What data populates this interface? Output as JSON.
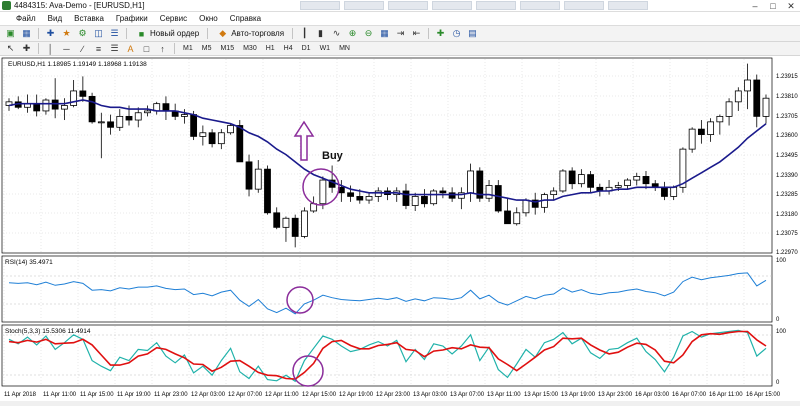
{
  "window": {
    "title": "4484315: Ava-Demo - [EURUSD,H1]"
  },
  "menu": [
    "Файл",
    "Вид",
    "Вставка",
    "Графики",
    "Сервис",
    "Окно",
    "Справка"
  ],
  "toolbar": {
    "new_order": "Новый ордер",
    "autotrading": "Авто-торговля"
  },
  "timeframes": [
    "M1",
    "M5",
    "M15",
    "M30",
    "H1",
    "H4",
    "D1",
    "W1",
    "MN"
  ],
  "main_chart": {
    "header": "EURUSD,H1  1.18985 1.19149 1.18968 1.19138",
    "price_labels": [
      "1.23915",
      "1.23810",
      "1.23705",
      "1.23600",
      "1.23495",
      "1.23390",
      "1.23285",
      "1.23180",
      "1.23075",
      "1.22970"
    ],
    "annotation_buy": "Buy"
  },
  "rsi": {
    "header": "RSI(14) 35.4971",
    "scale": [
      "100",
      "0"
    ]
  },
  "stoch": {
    "header": "Stoch(5,3,3) 15.5306 11.4914",
    "scale": [
      "100",
      "0"
    ]
  },
  "time_labels": [
    "11 Apr 2018",
    "11 Apr 11:00",
    "11 Apr 15:00",
    "11 Apr 19:00",
    "11 Apr 23:00",
    "12 Apr 03:00",
    "12 Apr 07:00",
    "12 Apr 11:00",
    "12 Apr 15:00",
    "12 Apr 19:00",
    "12 Apr 23:00",
    "13 Apr 03:00",
    "13 Apr 07:00",
    "13 Apr 11:00",
    "13 Apr 15:00",
    "13 Apr 19:00",
    "13 Apr 23:00",
    "16 Apr 03:00",
    "16 Apr 07:00",
    "16 Apr 11:00",
    "16 Apr 15:00"
  ],
  "colors": {
    "ma": "#1a1a8c",
    "rsi": "#1e7fd6",
    "stoch_main": "#20b2aa",
    "stoch_signal": "#e01010",
    "annotation": "#8b2d9b"
  },
  "chart_data": {
    "type": "candlestick",
    "symbol": "EURUSD",
    "timeframe": "H1",
    "ylim": [
      1.2292,
      1.2397
    ],
    "candles": [
      [
        1.2372,
        1.2376,
        1.2369,
        1.2374
      ],
      [
        1.2374,
        1.2377,
        1.237,
        1.2371
      ],
      [
        1.2371,
        1.2378,
        1.2368,
        1.2373
      ],
      [
        1.2373,
        1.2378,
        1.2366,
        1.2369
      ],
      [
        1.2369,
        1.2376,
        1.2367,
        1.2375
      ],
      [
        1.2375,
        1.2387,
        1.2365,
        1.237
      ],
      [
        1.237,
        1.2376,
        1.2364,
        1.2372
      ],
      [
        1.2372,
        1.2386,
        1.2371,
        1.238
      ],
      [
        1.238,
        1.2388,
        1.2374,
        1.2377
      ],
      [
        1.2377,
        1.2379,
        1.2362,
        1.2363
      ],
      [
        1.2363,
        1.2368,
        1.2343,
        1.2363
      ],
      [
        1.2363,
        1.2367,
        1.2356,
        1.236
      ],
      [
        1.236,
        1.237,
        1.2358,
        1.2366
      ],
      [
        1.2366,
        1.2372,
        1.2361,
        1.2364
      ],
      [
        1.2364,
        1.2371,
        1.236,
        1.2368
      ],
      [
        1.2368,
        1.2372,
        1.2366,
        1.2369
      ],
      [
        1.2369,
        1.2374,
        1.2367,
        1.2373
      ],
      [
        1.2373,
        1.2377,
        1.2364,
        1.2369
      ],
      [
        1.2369,
        1.2373,
        1.2364,
        1.2366
      ],
      [
        1.2366,
        1.237,
        1.2362,
        1.2367
      ],
      [
        1.2367,
        1.2369,
        1.2353,
        1.2355
      ],
      [
        1.2355,
        1.2361,
        1.235,
        1.2357
      ],
      [
        1.2357,
        1.2359,
        1.2349,
        1.2351
      ],
      [
        1.2351,
        1.2359,
        1.2348,
        1.2357
      ],
      [
        1.2357,
        1.2362,
        1.2356,
        1.2361
      ],
      [
        1.2361,
        1.2364,
        1.2341,
        1.2341
      ],
      [
        1.2341,
        1.2345,
        1.2322,
        1.2326
      ],
      [
        1.2326,
        1.2342,
        1.2324,
        1.2337
      ],
      [
        1.2337,
        1.2339,
        1.2312,
        1.2313
      ],
      [
        1.2313,
        1.2316,
        1.2304,
        1.2305
      ],
      [
        1.2305,
        1.2311,
        1.2297,
        1.231
      ],
      [
        1.231,
        1.2312,
        1.2294,
        1.23
      ],
      [
        1.23,
        1.2316,
        1.2299,
        1.2314
      ],
      [
        1.2314,
        1.2322,
        1.2313,
        1.2318
      ],
      [
        1.2318,
        1.2333,
        1.2315,
        1.2331
      ],
      [
        1.2331,
        1.2339,
        1.2324,
        1.2327
      ],
      [
        1.2327,
        1.2331,
        1.2319,
        1.2324
      ],
      [
        1.2324,
        1.2328,
        1.2319,
        1.2322
      ],
      [
        1.2322,
        1.2326,
        1.2318,
        1.232
      ],
      [
        1.232,
        1.2324,
        1.2318,
        1.2322
      ],
      [
        1.2322,
        1.2327,
        1.2319,
        1.2325
      ],
      [
        1.2325,
        1.2327,
        1.232,
        1.2323
      ],
      [
        1.2323,
        1.2327,
        1.2319,
        1.2325
      ],
      [
        1.2325,
        1.2329,
        1.2315,
        1.2317
      ],
      [
        1.2317,
        1.2324,
        1.2314,
        1.2322
      ],
      [
        1.2322,
        1.2326,
        1.2316,
        1.2318
      ],
      [
        1.2318,
        1.2326,
        1.2317,
        1.2325
      ],
      [
        1.2325,
        1.2327,
        1.2321,
        1.2324
      ],
      [
        1.2324,
        1.2327,
        1.2319,
        1.2321
      ],
      [
        1.2321,
        1.2327,
        1.2315,
        1.2324
      ],
      [
        1.2324,
        1.234,
        1.2319,
        1.2336
      ],
      [
        1.2336,
        1.2338,
        1.2319,
        1.2321
      ],
      [
        1.2321,
        1.2331,
        1.2319,
        1.2328
      ],
      [
        1.2328,
        1.2331,
        1.2313,
        1.2314
      ],
      [
        1.2314,
        1.2321,
        1.2307,
        1.2307
      ],
      [
        1.2307,
        1.2316,
        1.2306,
        1.2313
      ],
      [
        1.2313,
        1.2321,
        1.2311,
        1.232
      ],
      [
        1.232,
        1.2324,
        1.2312,
        1.2316
      ],
      [
        1.2316,
        1.2324,
        1.2313,
        1.2323
      ],
      [
        1.2323,
        1.2327,
        1.232,
        1.2325
      ],
      [
        1.2325,
        1.2337,
        1.2324,
        1.2336
      ],
      [
        1.2336,
        1.2338,
        1.2326,
        1.2329
      ],
      [
        1.2329,
        1.2337,
        1.2327,
        1.2334
      ],
      [
        1.2334,
        1.2336,
        1.2324,
        1.2327
      ],
      [
        1.2327,
        1.2329,
        1.2322,
        1.2325
      ],
      [
        1.2325,
        1.2331,
        1.2323,
        1.2327
      ],
      [
        1.2327,
        1.233,
        1.2325,
        1.2328
      ],
      [
        1.2328,
        1.2332,
        1.2326,
        1.2331
      ],
      [
        1.2331,
        1.2335,
        1.2328,
        1.2333
      ],
      [
        1.2333,
        1.2336,
        1.2326,
        1.2329
      ],
      [
        1.2329,
        1.2331,
        1.2325,
        1.2327
      ],
      [
        1.2327,
        1.233,
        1.232,
        1.2322
      ],
      [
        1.2322,
        1.2328,
        1.232,
        1.2327
      ],
      [
        1.2327,
        1.2349,
        1.2324,
        1.2348
      ],
      [
        1.2348,
        1.236,
        1.2346,
        1.2359
      ],
      [
        1.2359,
        1.2364,
        1.2351,
        1.2356
      ],
      [
        1.2356,
        1.2365,
        1.2352,
        1.2363
      ],
      [
        1.2363,
        1.2367,
        1.2356,
        1.2366
      ],
      [
        1.2366,
        1.2376,
        1.2361,
        1.2374
      ],
      [
        1.2374,
        1.2382,
        1.2369,
        1.238
      ],
      [
        1.238,
        1.2395,
        1.237,
        1.2386
      ],
      [
        1.2386,
        1.2389,
        1.236,
        1.2366
      ],
      [
        1.2366,
        1.2378,
        1.2362,
        1.2376
      ]
    ],
    "ma": [
      1.2372,
      1.2373,
      1.2373,
      1.2373,
      1.2373,
      1.2373,
      1.2373,
      1.2374,
      1.2375,
      1.2374,
      1.2372,
      1.2371,
      1.2371,
      1.237,
      1.237,
      1.237,
      1.2369,
      1.2369,
      1.2369,
      1.2368,
      1.2367,
      1.2365,
      1.2364,
      1.2363,
      1.2362,
      1.236,
      1.2357,
      1.2355,
      1.2352,
      1.2348,
      1.2345,
      1.2341,
      1.2337,
      1.2334,
      1.2332,
      1.233,
      1.2328,
      1.2326,
      1.2325,
      1.2324,
      1.2324,
      1.2324,
      1.2324,
      1.2323,
      1.2323,
      1.2323,
      1.2323,
      1.2323,
      1.2323,
      1.2323,
      1.2324,
      1.2323,
      1.2323,
      1.2322,
      1.2321,
      1.232,
      1.232,
      1.2319,
      1.232,
      1.232,
      1.2322,
      1.2323,
      1.2324,
      1.2324,
      1.2325,
      1.2325,
      1.2326,
      1.2326,
      1.2327,
      1.2327,
      1.2327,
      1.2327,
      1.2327,
      1.2329,
      1.2332,
      1.2335,
      1.2338,
      1.2341,
      1.2345,
      1.2349,
      1.2354,
      1.2358,
      1.2362
    ],
    "rsi": [
      60,
      59,
      60,
      57,
      61,
      56,
      58,
      62,
      59,
      48,
      49,
      47,
      52,
      50,
      53,
      53,
      55,
      51,
      49,
      50,
      41,
      43,
      39,
      45,
      48,
      32,
      22,
      33,
      18,
      12,
      19,
      10,
      26,
      32,
      40,
      36,
      33,
      32,
      31,
      33,
      35,
      33,
      36,
      30,
      34,
      31,
      36,
      35,
      33,
      36,
      48,
      34,
      40,
      29,
      24,
      31,
      38,
      34,
      40,
      42,
      52,
      45,
      49,
      43,
      41,
      44,
      45,
      48,
      50,
      46,
      44,
      39,
      45,
      62,
      69,
      65,
      68,
      70,
      72,
      75,
      76,
      55,
      64
    ],
    "stoch_main": [
      78,
      70,
      82,
      68,
      84,
      60,
      72,
      86,
      78,
      40,
      30,
      22,
      46,
      40,
      60,
      58,
      72,
      48,
      36,
      50,
      18,
      30,
      14,
      40,
      62,
      20,
      8,
      30,
      6,
      4,
      14,
      3,
      40,
      62,
      84,
      78,
      66,
      56,
      60,
      68,
      74,
      66,
      76,
      38,
      60,
      42,
      70,
      66,
      52,
      66,
      86,
      40,
      64,
      24,
      10,
      34,
      60,
      46,
      72,
      78,
      90,
      70,
      80,
      54,
      44,
      60,
      62,
      72,
      80,
      56,
      42,
      20,
      46,
      84,
      92,
      82,
      88,
      90,
      92,
      94,
      90,
      48,
      62
    ],
    "stoch_signal": [
      74,
      72,
      76,
      73,
      78,
      70,
      71,
      72,
      78,
      68,
      50,
      32,
      32,
      36,
      48,
      52,
      63,
      60,
      52,
      45,
      34,
      33,
      21,
      28,
      39,
      40,
      30,
      19,
      14,
      13,
      8,
      7,
      19,
      35,
      62,
      74,
      76,
      67,
      61,
      61,
      67,
      69,
      72,
      60,
      58,
      47,
      57,
      59,
      63,
      61,
      68,
      64,
      63,
      43,
      33,
      22,
      34,
      46,
      59,
      65,
      80,
      79,
      80,
      68,
      59,
      52,
      55,
      64,
      71,
      69,
      59,
      39,
      36,
      50,
      74,
      86,
      88,
      87,
      90,
      92,
      92,
      77,
      66
    ]
  }
}
